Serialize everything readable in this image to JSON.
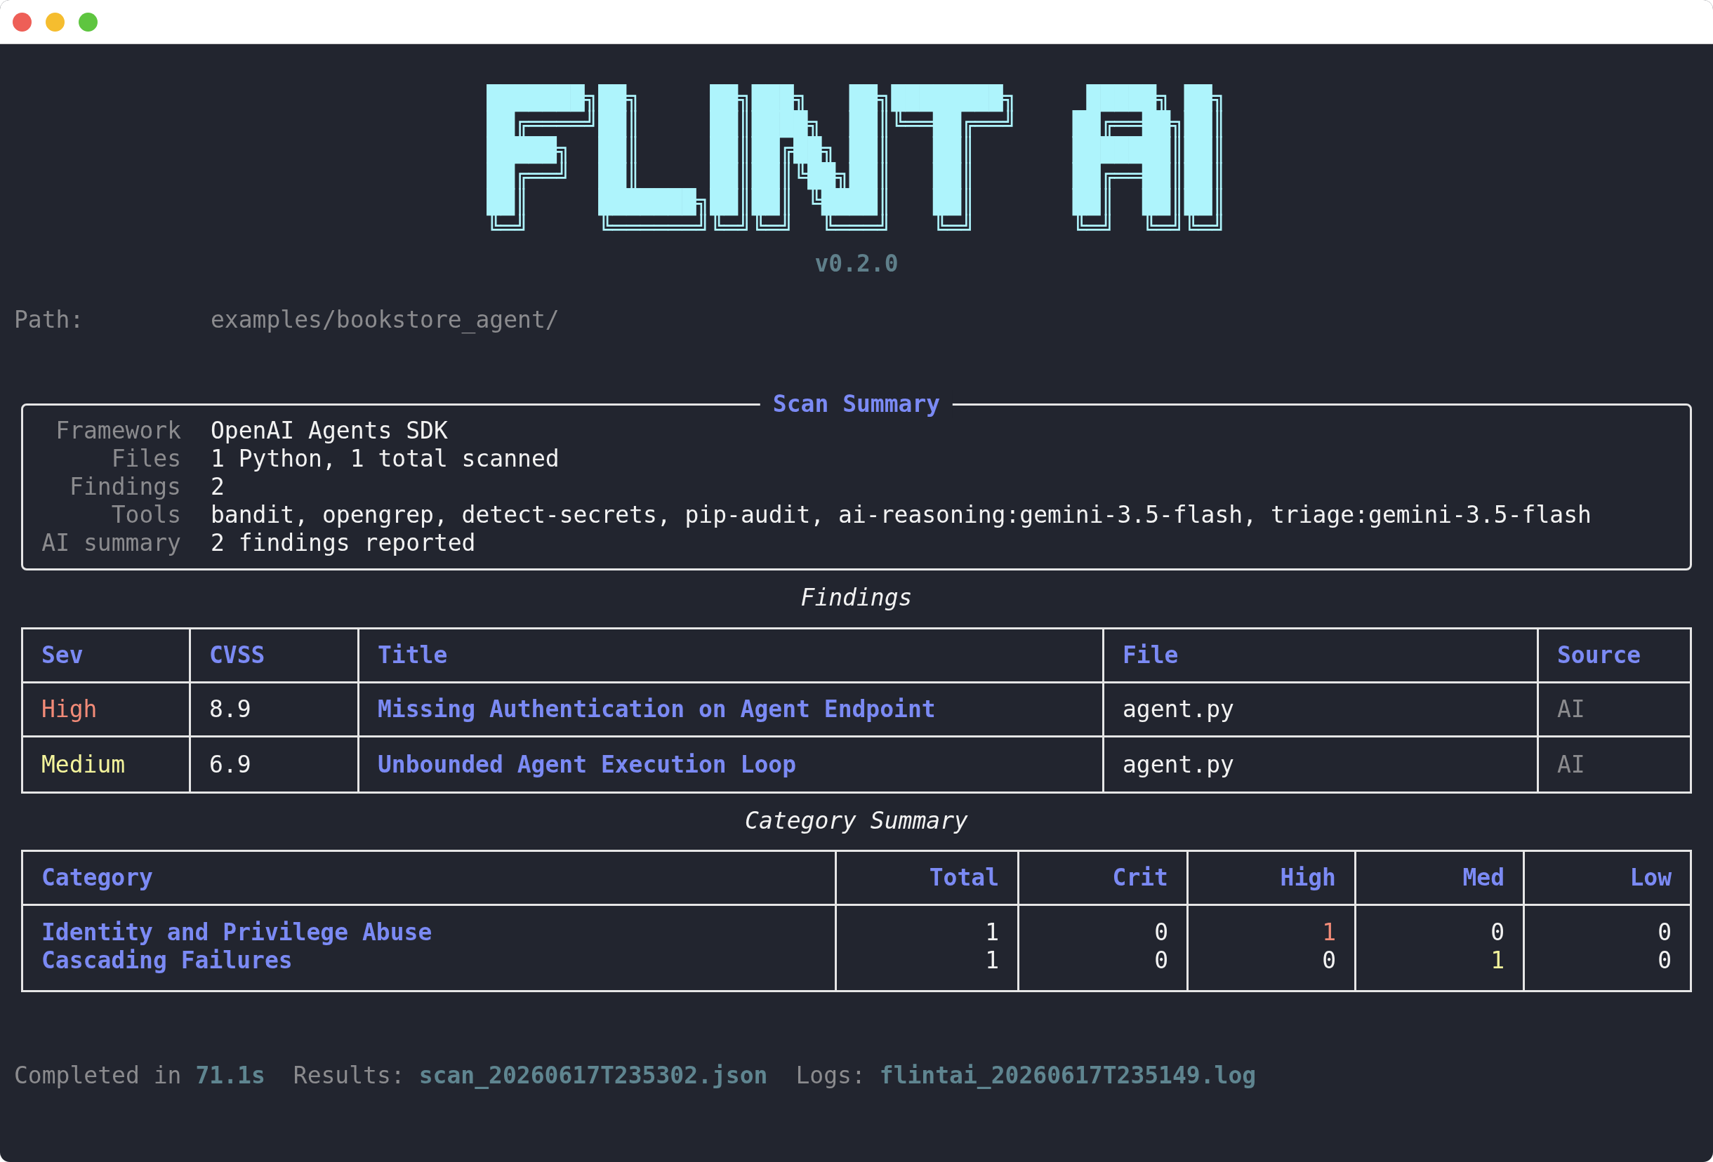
{
  "banner": {
    "logo_lines": [
      "███████╗██╗     ██╗███╗   ██╗████████╗     █████╗ ██╗",
      "██╔════╝██║     ██║████╗  ██║╚══██╔══╝    ██╔══██╗██║",
      "█████╗  ██║     ██║██╔██╗ ██║   ██║       ███████║██║",
      "██╔══╝  ██║     ██║██║╚██╗██║   ██║       ██╔══██║██║",
      "██║     ███████╗██║██║ ╚████║   ██║       ██║  ██║██║",
      "╚═╝     ╚══════╝╚═╝╚═╝  ╚═══╝   ╚═╝       ╚═╝  ╚═╝╚═╝"
    ],
    "version": "v0.2.0"
  },
  "path": {
    "label": "Path:",
    "value": "examples/bookstore_agent/"
  },
  "scan_summary": {
    "title": "Scan Summary",
    "rows": [
      {
        "label": "Framework",
        "value": "OpenAI Agents SDK"
      },
      {
        "label": "Files",
        "value": "1 Python, 1 total scanned"
      },
      {
        "label": "Findings",
        "value": "2"
      },
      {
        "label": "Tools",
        "value": "bandit, opengrep, detect-secrets, pip-audit, ai-reasoning:gemini-3.5-flash, triage:gemini-3.5-flash"
      },
      {
        "label": "AI summary",
        "value": "2 findings reported"
      }
    ]
  },
  "findings": {
    "title": "Findings",
    "columns": [
      {
        "label": "Sev",
        "kind": "plain"
      },
      {
        "label": "CVSS",
        "kind": "plain"
      },
      {
        "label": "Title",
        "kind": "title"
      },
      {
        "label": "File",
        "kind": "plain"
      },
      {
        "label": "Source",
        "kind": "muted"
      }
    ],
    "rows": [
      {
        "cells": [
          {
            "text": "High",
            "color": "#f28b78"
          },
          "8.9",
          "Missing Authentication on Agent Endpoint",
          "agent.py",
          "AI"
        ]
      },
      {
        "cells": [
          {
            "text": "Medium",
            "color": "#f4f49c"
          },
          "6.9",
          "Unbounded Agent Execution Loop",
          "agent.py",
          "AI"
        ]
      }
    ]
  },
  "category_summary": {
    "title": "Category Summary",
    "columns": [
      {
        "label": "Category",
        "kind": "title"
      },
      {
        "label": "Total",
        "kind": "number"
      },
      {
        "label": "Crit",
        "kind": "number"
      },
      {
        "label": "High",
        "kind": "number"
      },
      {
        "label": "Med",
        "kind": "number"
      },
      {
        "label": "Low",
        "kind": "number"
      }
    ],
    "rows": [
      {
        "cells": [
          "Identity and Privilege Abuse",
          "1",
          "0",
          {
            "text": "1",
            "color": "#f28b78"
          },
          "0",
          "0"
        ]
      },
      {
        "cells": [
          "Cascading Failures",
          "1",
          "0",
          "0",
          {
            "text": "1",
            "color": "#f4f49c"
          },
          "0"
        ]
      }
    ]
  },
  "footer": [
    {
      "label": "Completed in",
      "value": "71.1s"
    },
    {
      "label": "Results:",
      "value": "scan_20260617T235302.json"
    },
    {
      "label": "Logs:",
      "value": "flintai_20260617T235149.log"
    }
  ]
}
